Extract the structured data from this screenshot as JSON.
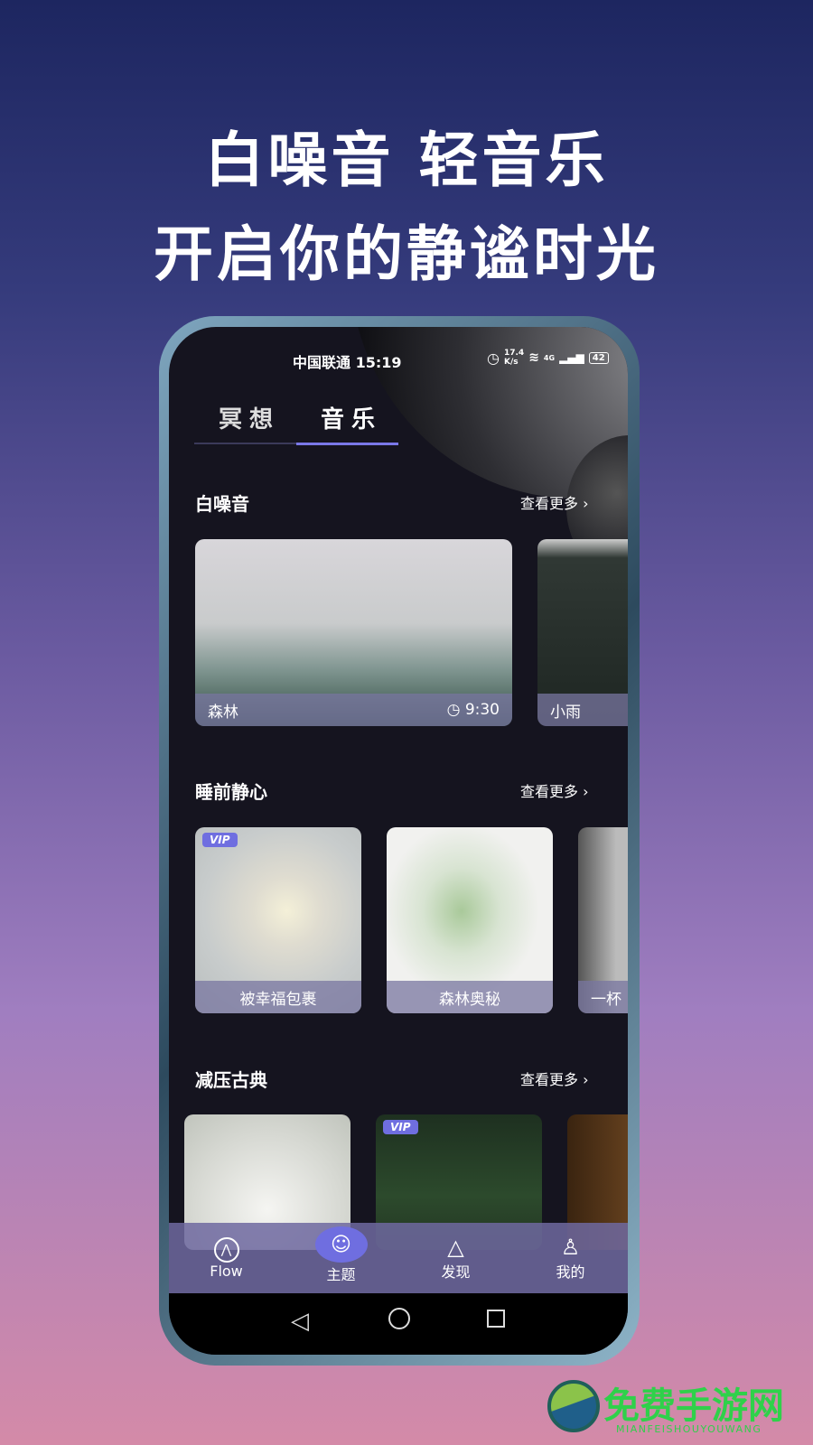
{
  "headline": {
    "line1": "白噪音 轻音乐",
    "line2": "开启你的静谧时光"
  },
  "status_bar": {
    "carrier_time": "中国联通 15:19",
    "speed": "17.4",
    "speed_unit": "K/s",
    "network": "4G",
    "battery": "42"
  },
  "tabs": [
    {
      "label": "冥想",
      "active": false
    },
    {
      "label": "音乐",
      "active": true
    }
  ],
  "sections": [
    {
      "title": "白噪音",
      "more": "查看更多 ›",
      "cards": [
        {
          "label": "森林",
          "duration": "9:30"
        },
        {
          "label": "小雨"
        }
      ]
    },
    {
      "title": "睡前静心",
      "more": "查看更多 ›",
      "cards": [
        {
          "label": "被幸福包裹",
          "badge": "VIP"
        },
        {
          "label": "森林奥秘"
        },
        {
          "label": "一杯"
        }
      ]
    },
    {
      "title": "减压古典",
      "more": "查看更多 ›",
      "cards": [
        {
          "label": ""
        },
        {
          "label": "",
          "badge": "VIP"
        },
        {
          "label": ""
        }
      ]
    }
  ],
  "bottom_nav": [
    {
      "label": "Flow",
      "icon": "flow-icon"
    },
    {
      "label": "主题",
      "icon": "meditation-icon",
      "active": true
    },
    {
      "label": "发现",
      "icon": "pyramid-icon"
    },
    {
      "label": "我的",
      "icon": "user-icon"
    }
  ],
  "watermark": {
    "text": "免费手游网",
    "sub": "MIANFEISHOUYOUWANG"
  },
  "colors": {
    "accent": "#6f6ee0",
    "watermark": "#2fd14a"
  }
}
